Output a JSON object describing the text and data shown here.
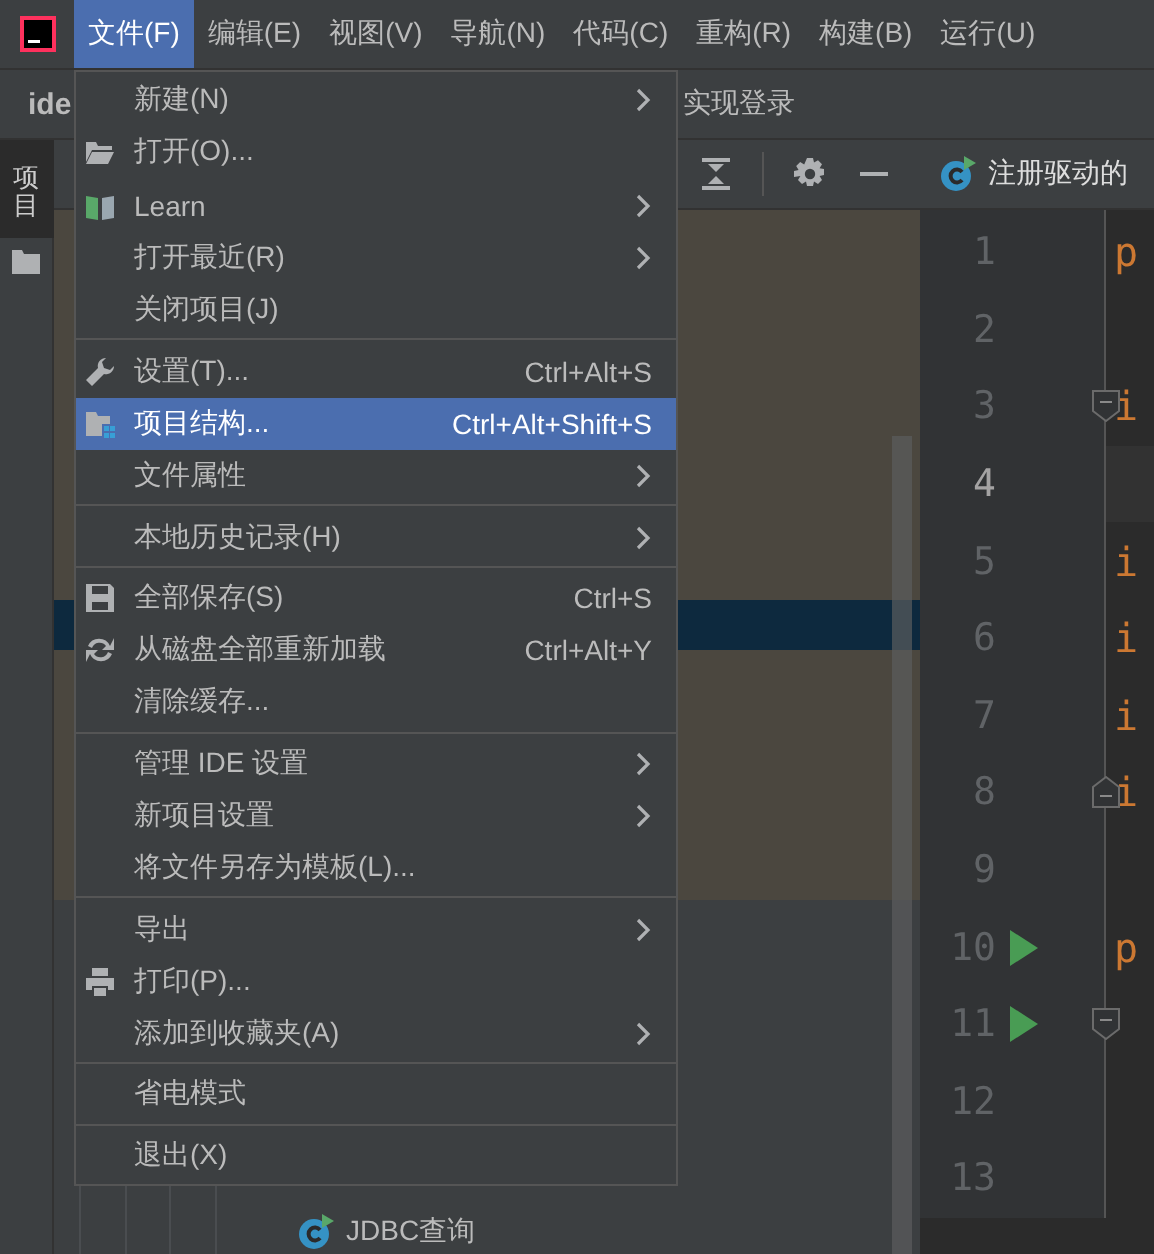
{
  "menu_bar": {
    "items": [
      {
        "label": "文件(F)",
        "selected": true
      },
      {
        "label": "编辑(E)",
        "selected": false
      },
      {
        "label": "视图(V)",
        "selected": false
      },
      {
        "label": "导航(N)",
        "selected": false
      },
      {
        "label": "代码(C)",
        "selected": false
      },
      {
        "label": "重构(R)",
        "selected": false
      },
      {
        "label": "构建(B)",
        "selected": false
      },
      {
        "label": "运行(U)",
        "selected": false
      }
    ]
  },
  "navigation_bar": {
    "project": "ide",
    "file": "实现登录"
  },
  "tool_stripe": {
    "tabs": [
      {
        "label": "项目",
        "selected": true
      }
    ]
  },
  "project_panel": {
    "tree_items": [
      {
        "label": "JDBC查询"
      }
    ]
  },
  "editor": {
    "tab": {
      "label": "注册驱动的"
    },
    "lines": [
      {
        "number": "1",
        "text": "p",
        "current": false,
        "run": false,
        "fold_open": false,
        "fold_close": false
      },
      {
        "number": "2",
        "current": false,
        "run": false,
        "fold_open": false,
        "fold_close": false
      },
      {
        "number": "3",
        "text": "i",
        "current": false,
        "run": false,
        "fold_open": true,
        "fold_close": false
      },
      {
        "number": "4",
        "current": true,
        "run": false,
        "fold_open": false,
        "fold_close": false
      },
      {
        "number": "5",
        "text": "i",
        "current": false,
        "run": false,
        "fold_open": false,
        "fold_close": false
      },
      {
        "number": "6",
        "text": "i",
        "current": false,
        "run": false,
        "fold_open": false,
        "fold_close": false
      },
      {
        "number": "7",
        "text": "i",
        "current": false,
        "run": false,
        "fold_open": false,
        "fold_close": false
      },
      {
        "number": "8",
        "text": "i",
        "current": false,
        "run": false,
        "fold_open": false,
        "fold_close": true
      },
      {
        "number": "9",
        "current": false,
        "run": false,
        "fold_open": false,
        "fold_close": false
      },
      {
        "number": "10",
        "text": "p",
        "current": false,
        "run": true,
        "fold_open": false,
        "fold_close": false
      },
      {
        "number": "11",
        "current": false,
        "run": true,
        "fold_open": true,
        "fold_close": false
      },
      {
        "number": "12",
        "current": false,
        "run": false,
        "fold_open": false,
        "fold_close": false
      },
      {
        "number": "13",
        "current": false,
        "run": false,
        "fold_open": false,
        "fold_close": false
      }
    ]
  },
  "file_menu": {
    "entries": [
      {
        "kind": "item",
        "label": "新建(N)",
        "submenu": true,
        "selected": false
      },
      {
        "kind": "item",
        "label": "打开(O)...",
        "submenu": false,
        "selected": false
      },
      {
        "kind": "item",
        "label": "Learn",
        "submenu": true,
        "selected": false
      },
      {
        "kind": "item",
        "label": "打开最近(R)",
        "submenu": true,
        "selected": false
      },
      {
        "kind": "item",
        "label": "关闭项目(J)",
        "submenu": false,
        "selected": false
      },
      {
        "kind": "separator"
      },
      {
        "kind": "item",
        "label": "设置(T)...",
        "shortcut": "Ctrl+Alt+S",
        "submenu": false,
        "selected": false
      },
      {
        "kind": "item",
        "label": "项目结构...",
        "shortcut": "Ctrl+Alt+Shift+S",
        "submenu": false,
        "selected": true
      },
      {
        "kind": "item",
        "label": "文件属性",
        "submenu": true,
        "selected": false
      },
      {
        "kind": "separator"
      },
      {
        "kind": "item",
        "label": "本地历史记录(H)",
        "submenu": true,
        "selected": false
      },
      {
        "kind": "separator"
      },
      {
        "kind": "item",
        "label": "全部保存(S)",
        "shortcut": "Ctrl+S",
        "submenu": false,
        "selected": false
      },
      {
        "kind": "item",
        "label": "从磁盘全部重新加载",
        "shortcut": "Ctrl+Alt+Y",
        "submenu": false,
        "selected": false
      },
      {
        "kind": "item",
        "label": "清除缓存...",
        "submenu": false,
        "selected": false
      },
      {
        "kind": "separator"
      },
      {
        "kind": "item",
        "label": "管理 IDE 设置",
        "submenu": true,
        "selected": false
      },
      {
        "kind": "item",
        "label": "新项目设置",
        "submenu": true,
        "selected": false
      },
      {
        "kind": "item",
        "label": "将文件另存为模板(L)...",
        "submenu": false,
        "selected": false
      },
      {
        "kind": "separator"
      },
      {
        "kind": "item",
        "label": "导出",
        "submenu": true,
        "selected": false
      },
      {
        "kind": "item",
        "label": "打印(P)...",
        "submenu": false,
        "selected": false
      },
      {
        "kind": "item",
        "label": "添加到收藏夹(A)",
        "submenu": true,
        "selected": false
      },
      {
        "kind": "separator"
      },
      {
        "kind": "item",
        "label": "省电模式",
        "submenu": false,
        "selected": false
      },
      {
        "kind": "separator"
      },
      {
        "kind": "item",
        "label": "退出(X)",
        "submenu": false,
        "selected": false
      }
    ]
  }
}
